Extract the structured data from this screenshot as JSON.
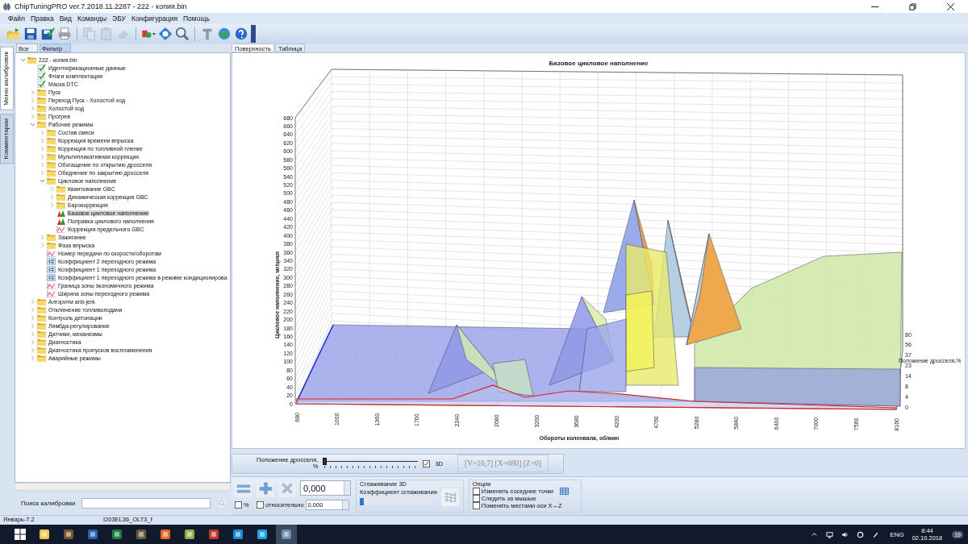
{
  "window": {
    "title": "ChipTuningPRO ver.7.2018.11.2287 - 222 - копия.bin"
  },
  "menu": [
    "Файл",
    "Правка",
    "Вид",
    "Команды",
    "ЭБУ",
    "Конфигурация",
    "Помощь"
  ],
  "side_tabs": [
    {
      "label": "Меню калибровок",
      "selected": true
    },
    {
      "label": "Комментарии",
      "selected": false
    }
  ],
  "tree_tabs": [
    {
      "label": "Все",
      "selected": false
    },
    {
      "label": "Фильтр",
      "selected": true
    }
  ],
  "tree": [
    {
      "label": "222 - копия.bin",
      "kind": "folder",
      "expanded": true,
      "selected": false,
      "children": [
        {
          "label": "Идентификационные данные",
          "kind": "check",
          "selected": false
        },
        {
          "label": "Флаги комплектации",
          "kind": "check",
          "selected": false
        },
        {
          "label": "Маска DTC",
          "kind": "check",
          "selected": false
        },
        {
          "label": "Пуск",
          "kind": "folder",
          "expanded": false,
          "selected": false
        },
        {
          "label": "Переход Пуск - Холостой ход",
          "kind": "folder",
          "expanded": false,
          "selected": false
        },
        {
          "label": "Холостой ход",
          "kind": "folder",
          "expanded": false,
          "selected": false
        },
        {
          "label": "Прогрев",
          "kind": "folder",
          "expanded": false,
          "selected": false
        },
        {
          "label": "Рабочие режимы",
          "kind": "folder",
          "expanded": true,
          "selected": false,
          "children": [
            {
              "label": "Состав смеси",
              "kind": "folder",
              "expanded": false,
              "selected": false
            },
            {
              "label": "Коррекция времени впрыска",
              "kind": "folder",
              "expanded": false,
              "selected": false
            },
            {
              "label": "Коррекция по топливной пленке",
              "kind": "folder",
              "expanded": false,
              "selected": false
            },
            {
              "label": "Мультипликативная коррекция",
              "kind": "folder",
              "expanded": false,
              "selected": false
            },
            {
              "label": "Обогащение по открытию дросселя",
              "kind": "folder",
              "expanded": false,
              "selected": false
            },
            {
              "label": "Обеднение по закрытию дросселя",
              "kind": "folder",
              "expanded": false,
              "selected": false
            },
            {
              "label": "Цикловое наполнение",
              "kind": "folder",
              "expanded": true,
              "selected": false,
              "children": [
                {
                  "label": "Квантование GBC",
                  "kind": "folder",
                  "expanded": false,
                  "selected": false
                },
                {
                  "label": "Динамическая коррекция GBC",
                  "kind": "folder",
                  "expanded": false,
                  "selected": false
                },
                {
                  "label": "Барокоррекция",
                  "kind": "folder",
                  "expanded": false,
                  "selected": false
                },
                {
                  "label": "Базовое цикловое наполнение",
                  "kind": "map",
                  "selected": true
                },
                {
                  "label": "Поправка циклового наполнения",
                  "kind": "map",
                  "selected": false
                },
                {
                  "label": "Коррекция предельного GBC",
                  "kind": "graph",
                  "selected": false
                }
              ]
            },
            {
              "label": "Зажигание",
              "kind": "folder",
              "expanded": false,
              "selected": false
            },
            {
              "label": "Фаза впрыска",
              "kind": "folder",
              "expanded": false,
              "selected": false
            },
            {
              "label": "Номер передачи по скорости/оборотам",
              "kind": "graph",
              "selected": false
            },
            {
              "label": "Коэффициент 2 переходного режима",
              "kind": "number",
              "selected": false
            },
            {
              "label": "Коэффициент 1 переходного режима",
              "kind": "number",
              "selected": false
            },
            {
              "label": "Коэффициент 1 переходного режима в режиме кондиционирова",
              "kind": "number",
              "selected": false
            },
            {
              "label": "Граница зоны экономичного режима",
              "kind": "graph",
              "selected": false
            },
            {
              "label": "Ширина зоны переходного режима",
              "kind": "graph",
              "selected": false
            }
          ]
        },
        {
          "label": "Алгоритм anti-jerk",
          "kind": "folder",
          "expanded": false,
          "selected": false
        },
        {
          "label": "Отключение топливоподачи",
          "kind": "folder",
          "expanded": false,
          "selected": false
        },
        {
          "label": "Контроль детонации",
          "kind": "folder",
          "expanded": false,
          "selected": false
        },
        {
          "label": "Лямбда-регулирование",
          "kind": "folder",
          "expanded": false,
          "selected": false
        },
        {
          "label": "Датчики, механизмы",
          "kind": "folder",
          "expanded": false,
          "selected": false
        },
        {
          "label": "Диагностика",
          "kind": "folder",
          "expanded": false,
          "selected": false
        },
        {
          "label": "Диагностика пропусков воспламенения",
          "kind": "folder",
          "expanded": false,
          "selected": false
        },
        {
          "label": "Аварийные режимы",
          "kind": "folder",
          "expanded": false,
          "selected": false
        }
      ]
    }
  ],
  "search": {
    "label": "Поиск калибровки"
  },
  "view_tabs": [
    {
      "label": "Поверхность",
      "selected": true
    },
    {
      "label": "Таблица",
      "selected": false
    }
  ],
  "chart": {
    "title": "Базовое цикловое наполнение",
    "ylabel": "Цикловое наполнение, мг/цикл",
    "xlabel": "Обороты коленвала, об/мин",
    "zlabel": "Положение дросселя,%",
    "yticks": [
      "680",
      "660",
      "640",
      "620",
      "600",
      "580",
      "560",
      "540",
      "520",
      "500",
      "480",
      "460",
      "440",
      "420",
      "400",
      "380",
      "360",
      "340",
      "320",
      "300",
      "280",
      "260",
      "240",
      "220",
      "200",
      "180",
      "160",
      "140",
      "120",
      "100",
      "80",
      "60",
      "40",
      "20",
      "0"
    ],
    "xticks": [
      "680",
      "1000",
      "1360",
      "1760",
      "2240",
      "2680",
      "3200",
      "3680",
      "4200",
      "4760",
      "5280",
      "5840",
      "6400",
      "7000",
      "7560",
      "8160"
    ],
    "zticks": [
      "80",
      "56",
      "37",
      "23",
      "14",
      "8",
      "4",
      "0"
    ]
  },
  "controls": {
    "throttle": {
      "label": "Положение дросселя,\n%",
      "level": 0
    },
    "three_d": {
      "label": "3D",
      "checked": true
    },
    "readout": "[V=10,7] [X=680] [Z=0]",
    "edit": {
      "value": "0,000",
      "percent": {
        "label": "%",
        "checked": false
      },
      "relative": {
        "label": "относительно",
        "checked": false
      },
      "relative_value": "0,000"
    },
    "smoothing": {
      "title": "Сглаживание 3D",
      "label": "Коэффициент сглаживания",
      "level": 0
    },
    "options": {
      "title": "Опции",
      "items": [
        {
          "label": "Изменять соседние точки",
          "checked": false
        },
        {
          "label": "Следить за мышью",
          "checked": false
        },
        {
          "label": "Поменять местами оси X↔Z",
          "checked": false
        }
      ]
    }
  },
  "status_bar": [
    "Январь-7.2",
    "I203EL36_OLT3_f"
  ],
  "taskbar": {
    "language": "ENG",
    "time": "8:44",
    "date": "02.10.2018",
    "notifications": "19"
  }
}
